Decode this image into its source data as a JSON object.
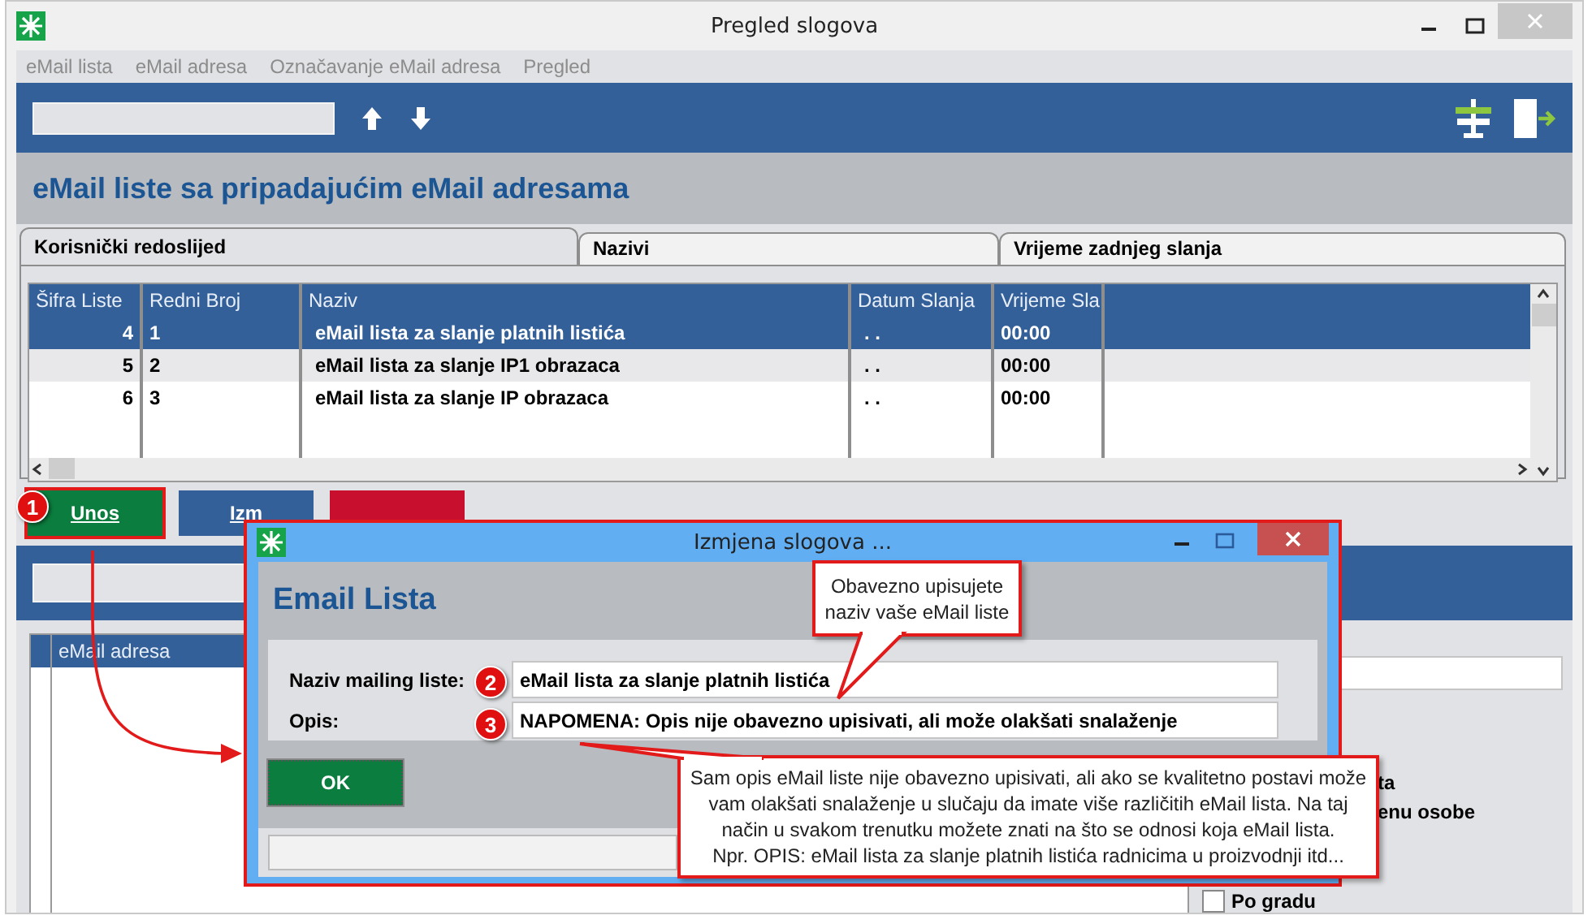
{
  "window": {
    "title": "Pregled slogova"
  },
  "menu": [
    "eMail lista",
    "eMail adresa",
    "Označavanje eMail adresa",
    "Pregled"
  ],
  "heading": "eMail liste sa pripadajućim eMail adresama",
  "tabs": [
    {
      "label": "Korisnički redoslijed",
      "selected": true
    },
    {
      "label": "Nazivi",
      "selected": false
    },
    {
      "label": "Vrijeme zadnjeg slanja",
      "selected": false
    }
  ],
  "table": {
    "columns": [
      "Šifra Liste",
      "Redni Broj",
      "Naziv",
      "Datum Slanja",
      "Vrijeme Sla"
    ],
    "rows": [
      {
        "cells": [
          "4",
          "1",
          "eMail lista za slanje platnih listića",
          ". .",
          "00:00"
        ],
        "selected": true
      },
      {
        "cells": [
          "5",
          "2",
          "eMail lista za slanje IP1 obrazaca",
          ". .",
          "00:00"
        ],
        "selected": false
      },
      {
        "cells": [
          "6",
          "3",
          "eMail lista za slanje IP obrazaca",
          ". .",
          "00:00"
        ],
        "selected": false
      }
    ]
  },
  "actions": [
    {
      "kind": "add",
      "label": "Unos"
    },
    {
      "kind": "edit",
      "label": "Izm"
    },
    {
      "kind": "delete"
    }
  ],
  "address_table": {
    "columns": [
      "eMail adresa"
    ]
  },
  "options": [
    {
      "kind": "text",
      "label": "ta"
    },
    {
      "kind": "text",
      "label": "enu osobe"
    },
    {
      "kind": "checkbox",
      "label": "Po gradu",
      "checked": false
    }
  ],
  "dialog": {
    "title": "Izmjena slogova ...",
    "heading": "Email Lista",
    "fields": [
      {
        "label": "Naziv mailing liste:",
        "value": "eMail lista za slanje platnih listića",
        "step": "2"
      },
      {
        "label": "Opis:",
        "value": "NAPOMENA: Opis nije obavezno upisivati, ali može olakšati snalaženje",
        "step": "3"
      }
    ],
    "ok": "OK"
  },
  "step_marker": "1",
  "callouts": [
    "Obavezno upisujete\nnaziv vaše eMail liste",
    "Sam opis eMail liste nije obavezno upisivati, ali ako se kvalitetno postavi može\nvam olakšati snalaženje u slučaju da imate više različitih eMail lista. Na taj\nnačin u svakom trenutku možete znati na što se odnosi koja eMail lista.\nNpr. OPIS: eMail lista za slanje platnih listića radnicima u proizvodnji itd..."
  ]
}
